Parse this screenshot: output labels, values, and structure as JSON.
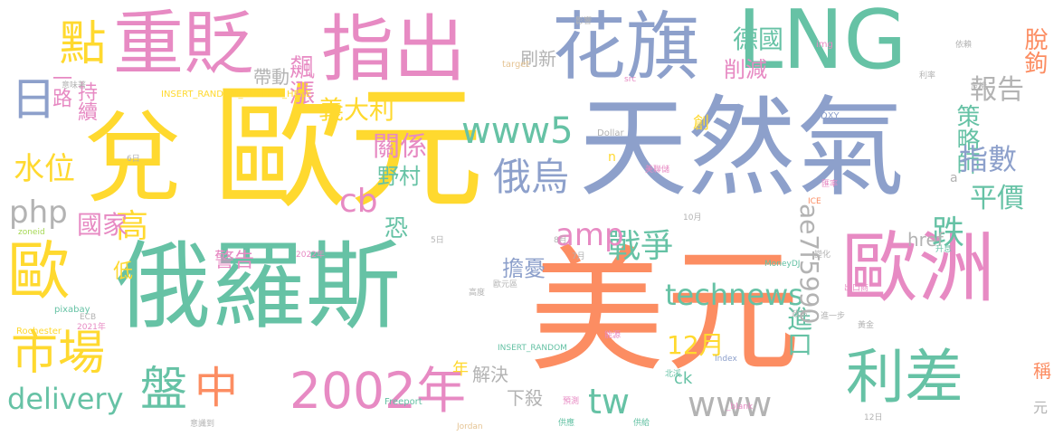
{
  "colors": {
    "orange": "#fc8d62",
    "pink": "#e78ac3",
    "green": "#66c2a5",
    "blue": "#8da0cb",
    "yellow": "#ffd92f",
    "lime": "#a6d854",
    "tan": "#e5c494",
    "gray": "#b3b3b3"
  },
  "words": [
    "歐元",
    "美元",
    "天然氣",
    "俄羅斯",
    "LNG",
    "花旗",
    "兌",
    "指出",
    "重貶",
    "歐洲",
    "利差",
    "歐",
    "市場",
    "2002年",
    "點",
    "盤",
    "中",
    "www5",
    "technews",
    "delivery",
    "策略師",
    "指數",
    "戰爭",
    "水位",
    "日",
    "平價",
    "俄烏",
    "跌",
    "amp",
    "tw",
    "www",
    "報告",
    "脫鉤",
    "關係",
    "高",
    "國家",
    "php",
    "cb",
    "義大利",
    "德國",
    "進口",
    "擔憂",
    "12月",
    "野村",
    "飆漲",
    "削減",
    "帶動",
    "刷新",
    "持續",
    "一路",
    "警告",
    "低",
    "恐",
    "ae7f5990",
    "href",
    "解決",
    "下殺",
    "稱",
    "ck",
    "年",
    "創",
    "元",
    "INSERT_RANDOM_NUMBER_HERE",
    "INSERT_RANDOM",
    "Rochester",
    "pixabay",
    "Freeport",
    "MoneyDJ",
    "Dollar",
    "DXY",
    "Index",
    "Jordan",
    "ICE",
    "ECB",
    "target",
    "src",
    "img",
    "a",
    "n",
    "_blank",
    "zoneid",
    "意味著",
    "6日",
    "5日",
    "7月",
    "8月",
    "10月",
    "12日",
    "2021年",
    "2022年",
    "高度",
    "歐元區",
    "北溪",
    "供給",
    "供應",
    "政策",
    "變化",
    "能源",
    "預測",
    "影響",
    "美聯儲",
    "利率",
    "依賴",
    "黃金",
    "出口商",
    "進一步",
    "危機",
    "升息",
    "匯率",
    "意識到"
  ]
}
